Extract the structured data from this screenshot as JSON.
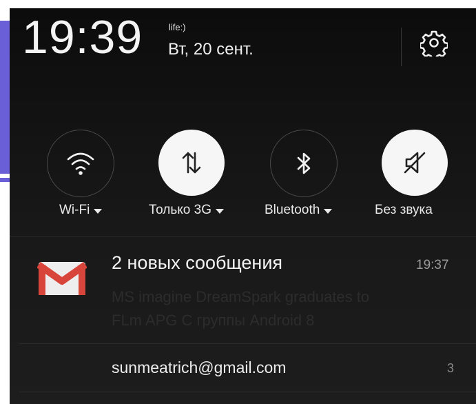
{
  "status": {
    "time": "19:39",
    "carrier": "life:)",
    "date": "Вт, 20 сент."
  },
  "quick_settings": [
    {
      "label": "Wi-Fi",
      "icon": "wifi-icon",
      "active": false,
      "dropdown": true
    },
    {
      "label": "Только 3G",
      "icon": "data-arrows-icon",
      "active": true,
      "dropdown": true
    },
    {
      "label": "Bluetooth",
      "icon": "bluetooth-icon",
      "active": false,
      "dropdown": true
    },
    {
      "label": "Без звука",
      "icon": "muted-speaker-icon",
      "active": true,
      "dropdown": false
    }
  ],
  "notification": {
    "app_icon": "gmail-icon",
    "title": "2 новых сообщения",
    "time": "19:37",
    "preview_line1": "MS imagine DreamSpark graduates to",
    "preview_line2": "FLm APG C группы Android 8",
    "account": "sunmeatrich@gmail.com",
    "count": "3"
  },
  "colors": {
    "accent_tab": "#6a5fd6",
    "shade_bg": "#141414",
    "active_toggle": "#f6f6f6",
    "gmail_red": "#d8453a"
  }
}
